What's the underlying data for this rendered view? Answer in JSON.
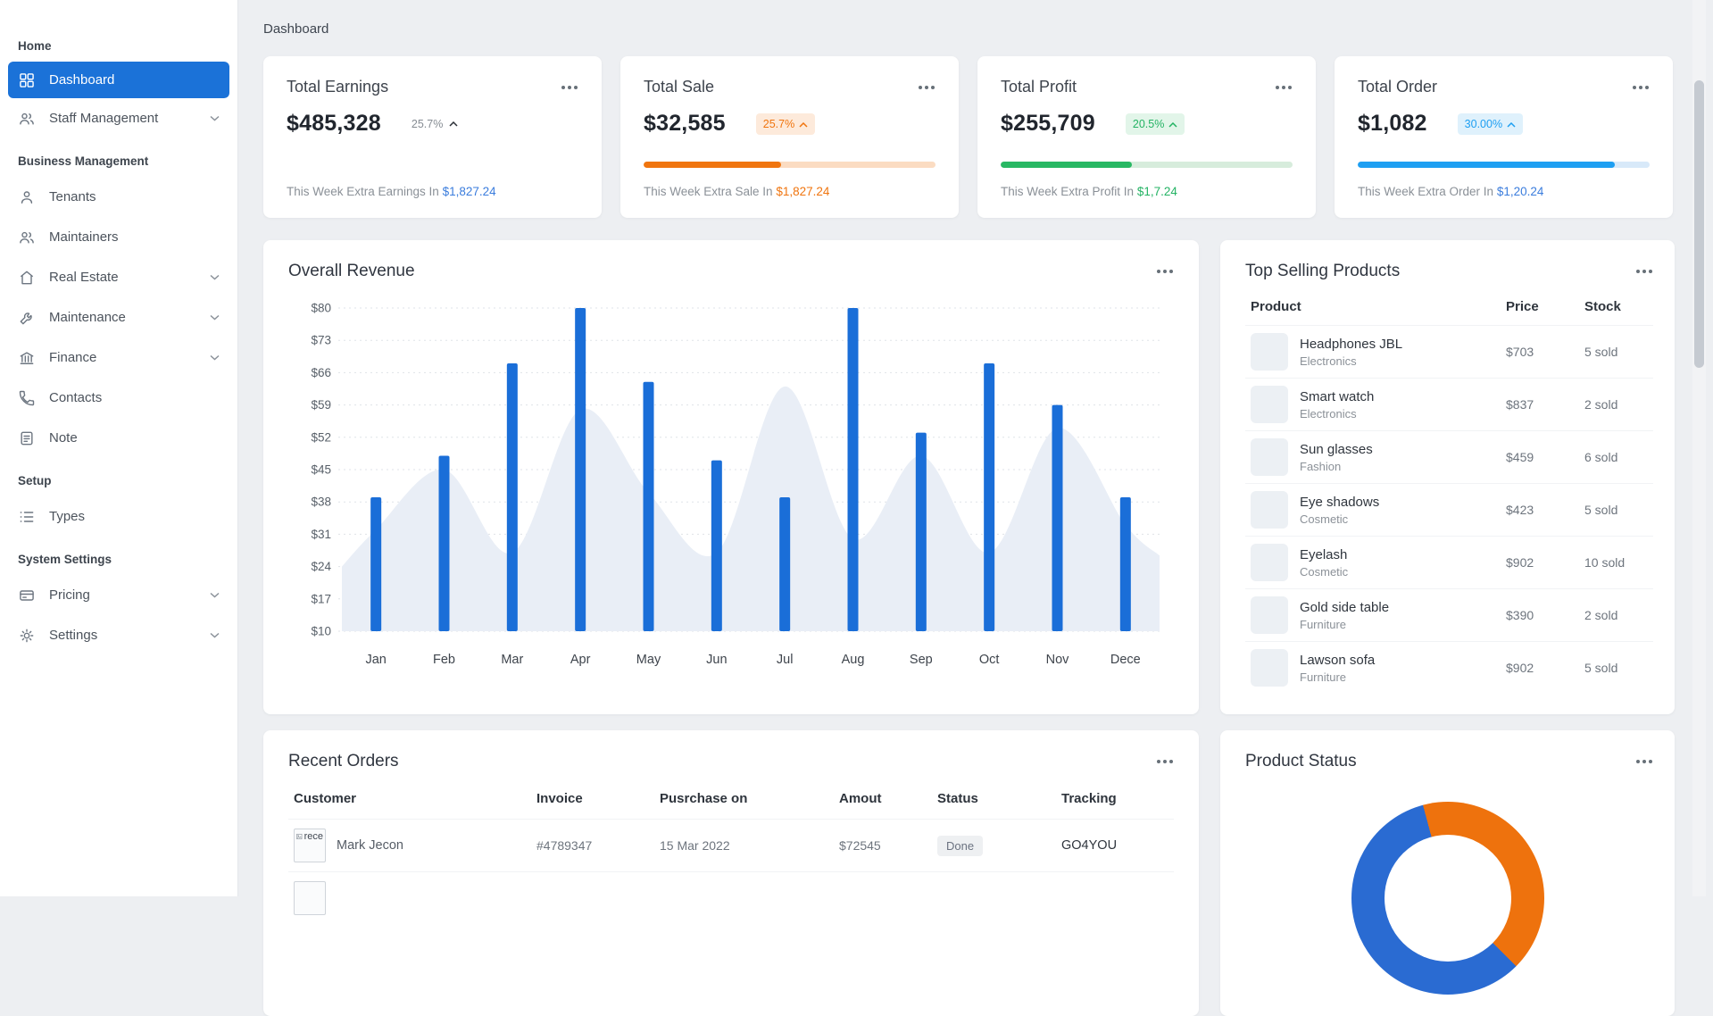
{
  "page": {
    "breadcrumb": "Dashboard"
  },
  "sidebar": {
    "sections": [
      {
        "label": "Home"
      },
      {
        "label": "Business Management"
      },
      {
        "label": "Setup"
      },
      {
        "label": "System Settings"
      }
    ],
    "items": {
      "dashboard": "Dashboard",
      "staff": "Staff Management",
      "tenants": "Tenants",
      "maintainers": "Maintainers",
      "real_estate": "Real Estate",
      "maintenance": "Maintenance",
      "finance": "Finance",
      "contacts": "Contacts",
      "note": "Note",
      "types": "Types",
      "pricing": "Pricing",
      "settings": "Settings"
    }
  },
  "stats": [
    {
      "title": "Total Earnings",
      "value": "$485,328",
      "delta": "25.7%",
      "footer_label": "This Week Extra Earnings In",
      "footer_amount": "$1,827.24"
    },
    {
      "title": "Total Sale",
      "value": "$32,585",
      "delta": "25.7%",
      "progress_percent": 47,
      "footer_label": "This Week Extra Sale In",
      "footer_amount": "$1,827.24"
    },
    {
      "title": "Total Profit",
      "value": "$255,709",
      "delta": "20.5%",
      "progress_percent": 45,
      "footer_label": "This Week Extra Profit In",
      "footer_amount": "$1,7.24"
    },
    {
      "title": "Total Order",
      "value": "$1,082",
      "delta": "30.00%",
      "progress_percent": 88,
      "footer_label": "This Week Extra Order In",
      "footer_amount": "$1,20.24"
    }
  ],
  "chart_data": [
    {
      "type": "bar",
      "title": "Overall Revenue",
      "categories": [
        "Jan",
        "Feb",
        "Mar",
        "Apr",
        "May",
        "Jun",
        "Jul",
        "Aug",
        "Sep",
        "Oct",
        "Nov",
        "Dece"
      ],
      "series": [
        {
          "name": "revenue-bars",
          "type": "bar",
          "color": "#1a6ed8",
          "values": [
            39,
            48,
            68,
            80,
            64,
            47,
            39,
            80,
            53,
            68,
            59,
            39
          ]
        },
        {
          "name": "background-trend-area",
          "type": "area",
          "color": "#e9eef6",
          "values": [
            32,
            45,
            27,
            58,
            40,
            27,
            63,
            30,
            48,
            27,
            54,
            33
          ]
        }
      ],
      "ylim": [
        10,
        80
      ],
      "yticks": [
        "$80",
        "$73",
        "$66",
        "$59",
        "$52",
        "$45",
        "$38",
        "$31",
        "$24",
        "$17",
        "$10"
      ],
      "grid": "dashed-horizontal",
      "legend": "none"
    },
    {
      "type": "pie",
      "title": "Product Status",
      "style": "donut",
      "start_deg": -15,
      "segments": [
        {
          "color": "#ee720d",
          "sweep_deg": 150
        },
        {
          "color": "#2a6bd2",
          "sweep_deg": 210
        }
      ],
      "note": "donut partially visible at bottom of viewport"
    }
  ],
  "top_products": {
    "title": "Top Selling Products",
    "columns": [
      "Product",
      "Price",
      "Stock"
    ],
    "rows": [
      {
        "name": "Headphones JBL",
        "category": "Electronics",
        "price": "$703",
        "stock": "5 sold"
      },
      {
        "name": "Smart watch",
        "category": "Electronics",
        "price": "$837",
        "stock": "2 sold"
      },
      {
        "name": "Sun glasses",
        "category": "Fashion",
        "price": "$459",
        "stock": "6 sold"
      },
      {
        "name": "Eye shadows",
        "category": "Cosmetic",
        "price": "$423",
        "stock": "5 sold"
      },
      {
        "name": "Eyelash",
        "category": "Cosmetic",
        "price": "$902",
        "stock": "10 sold"
      },
      {
        "name": "Gold side table",
        "category": "Furniture",
        "price": "$390",
        "stock": "2 sold"
      },
      {
        "name": "Lawson sofa",
        "category": "Furniture",
        "price": "$902",
        "stock": "5 sold"
      }
    ]
  },
  "recent_orders": {
    "title": "Recent Orders",
    "columns": [
      "Customer",
      "Invoice",
      "Pusrchase on",
      "Amout",
      "Status",
      "Tracking"
    ],
    "rows": [
      {
        "avatar_alt": "rece",
        "customer": "Mark Jecon",
        "invoice": "#4789347",
        "purchase_on": "15 Mar 2022",
        "amount": "$72545",
        "status": "Done",
        "tracking": "GO4YOU"
      }
    ]
  },
  "product_status": {
    "title": "Product Status"
  },
  "colors": {
    "sidebar_active": "#1b72d8",
    "accent_orange": "#f0750f",
    "accent_green": "#24b364",
    "accent_info_blue": "#1e9ff2",
    "accent_link_blue": "#3b7ddd",
    "bar_blue": "#1a6ed8",
    "donut_orange": "#ee720d",
    "donut_blue": "#2a6bd2",
    "background": "#edeff2"
  }
}
